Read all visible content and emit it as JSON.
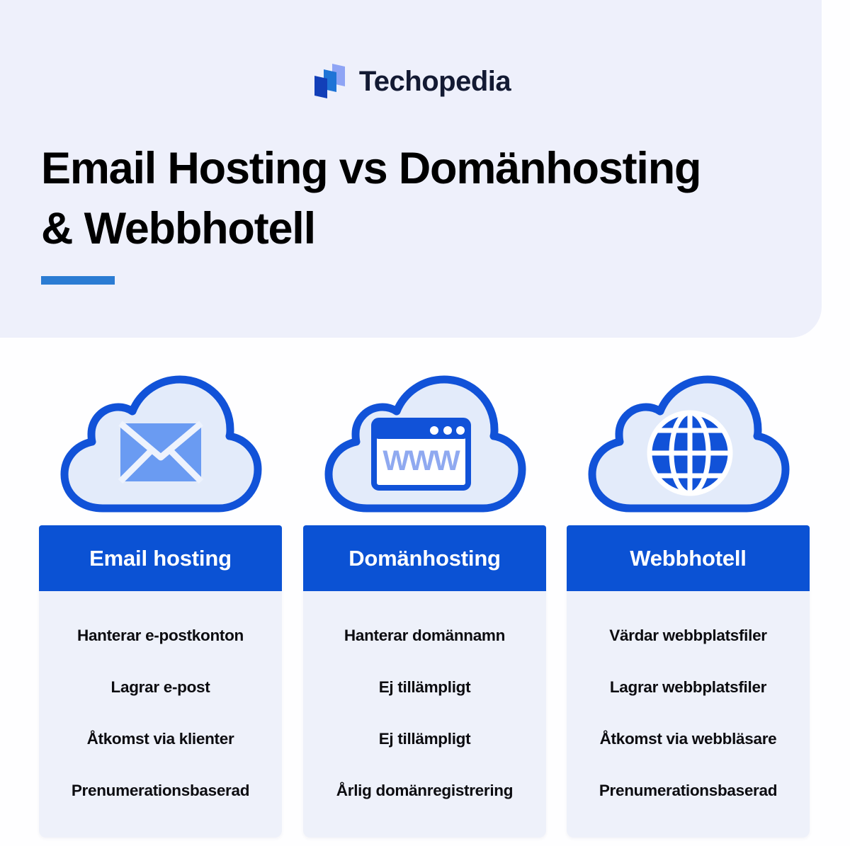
{
  "brand": {
    "name": "Techopedia",
    "logo_icon": "techopedia-layers-logo",
    "logo_colors": [
      "#123fb8",
      "#1f74d6",
      "#8ea4f5"
    ]
  },
  "header": {
    "title_line_1": "Email Hosting vs Domänhosting",
    "title_line_2": "& Webbhotell",
    "accent_color": "#2b7cd3",
    "panel_background": "#eef0fb"
  },
  "icons": [
    {
      "name": "cloud-email-icon",
      "label": "Email hosting cloud with envelope"
    },
    {
      "name": "cloud-browser-www-icon",
      "label": "Domain hosting cloud with WWW browser window"
    },
    {
      "name": "cloud-globe-icon",
      "label": "Web hosting cloud with globe"
    }
  ],
  "colors": {
    "header_blue": "#0b52d4",
    "cloud_stroke": "#1152d8",
    "cloud_fill": "#e3ebfa",
    "envelope": "#6a9bf2",
    "www_text": "#8fa9f0",
    "card_background": "#eef1fa",
    "text": "#0c0c10"
  },
  "comparison": {
    "columns": [
      {
        "header": "Email hosting",
        "features": [
          "Hanterar e-postkonton",
          "Lagrar e-post",
          "Åtkomst via klienter",
          "Prenumerationsbaserad"
        ]
      },
      {
        "header": "Domänhosting",
        "features": [
          "Hanterar domännamn",
          "Ej tillämpligt",
          "Ej tillämpligt",
          "Årlig domänregistrering"
        ]
      },
      {
        "header": "Webbhotell",
        "features": [
          "Värdar webbplatsfiler",
          "Lagrar webbplatsfiler",
          "Åtkomst via webbläsare",
          "Prenumerationsbaserad"
        ]
      }
    ]
  }
}
